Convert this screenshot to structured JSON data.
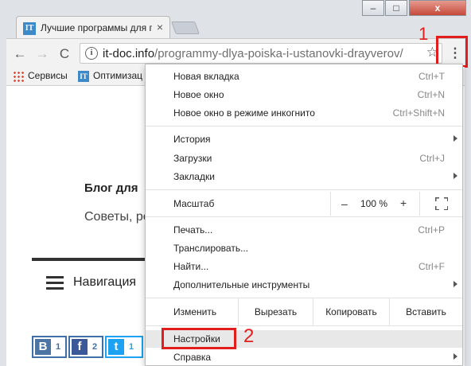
{
  "tab": {
    "title": "Лучшие программы для поиска",
    "favicon_text": "IT",
    "close_icon": "×"
  },
  "window_controls": {
    "minimize": "–",
    "maximize": "□",
    "close": "x"
  },
  "toolbar": {
    "back_icon": "←",
    "forward_icon": "→",
    "reload_icon": "C",
    "info_icon": "i",
    "url_host": "it-doc.info",
    "url_path": "/programmy-dlya-poiska-i-ustanovki-drayverov/",
    "star_icon": "☆",
    "menu_icon": "⋮"
  },
  "annotations": {
    "marker_1": "1",
    "marker_2": "2",
    "highlight_color": "#e21d1d"
  },
  "bookmarks": [
    {
      "label": "Сервисы",
      "icon": "apps-grid-icon"
    },
    {
      "label": "Оптимизац",
      "icon_text": "IT"
    }
  ],
  "page": {
    "blog_heading": "Блог для",
    "blog_tagline": "Советы, ре",
    "nav_label": "Навигация",
    "share": [
      {
        "icon": "B",
        "count": "1",
        "name": "vk"
      },
      {
        "icon": "f",
        "count": "2",
        "name": "facebook"
      },
      {
        "icon": "t",
        "count": "1",
        "name": "twitter"
      }
    ]
  },
  "menu": {
    "new_tab": {
      "label": "Новая вкладка",
      "shortcut": "Ctrl+T"
    },
    "new_window": {
      "label": "Новое окно",
      "shortcut": "Ctrl+N"
    },
    "incognito": {
      "label": "Новое окно в режиме инкогнито",
      "shortcut": "Ctrl+Shift+N"
    },
    "history": {
      "label": "История"
    },
    "downloads": {
      "label": "Загрузки",
      "shortcut": "Ctrl+J"
    },
    "bookmarks": {
      "label": "Закладки"
    },
    "zoom": {
      "label": "Масштаб",
      "minus": "–",
      "value": "100 %",
      "plus": "+"
    },
    "print": {
      "label": "Печать...",
      "shortcut": "Ctrl+P"
    },
    "cast": {
      "label": "Транслировать..."
    },
    "find": {
      "label": "Найти...",
      "shortcut": "Ctrl+F"
    },
    "more_tools": {
      "label": "Дополнительные инструменты"
    },
    "edit": {
      "label": "Изменить",
      "cut": "Вырезать",
      "copy": "Копировать",
      "paste": "Вставить"
    },
    "settings": {
      "label": "Настройки"
    },
    "help": {
      "label": "Справка"
    }
  }
}
